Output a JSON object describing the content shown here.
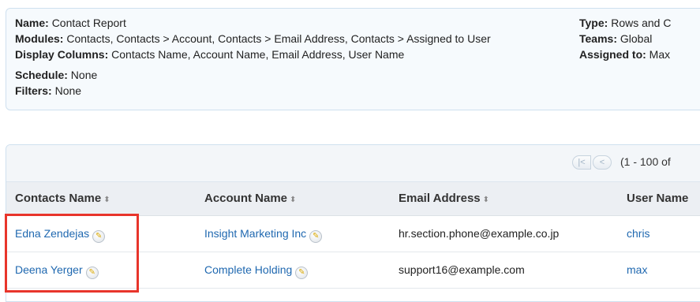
{
  "summary": {
    "name_label": "Name:",
    "name_value": "Contact Report",
    "modules_label": "Modules:",
    "modules_value": "Contacts, Contacts > Account, Contacts > Email Address, Contacts > Assigned to User",
    "display_label": "Display Columns:",
    "display_value": "Contacts Name, Account Name, Email Address, User Name",
    "schedule_label": "Schedule:",
    "schedule_value": "None",
    "filters_label": "Filters:",
    "filters_value": "None",
    "type_label": "Type:",
    "type_value": "Rows and C",
    "teams_label": "Teams:",
    "teams_value": "Global",
    "assigned_label": "Assigned to:",
    "assigned_value": "Max"
  },
  "pager": {
    "first_icon": "first-page-icon",
    "prev_icon": "prev-page-icon",
    "first_glyph": "|<",
    "prev_glyph": "<",
    "range": "(1 - 100 of"
  },
  "table": {
    "sort_glyph": "⬍",
    "columns": [
      "Contacts Name",
      "Account Name",
      "Email Address",
      "User Name"
    ],
    "rows": [
      {
        "contact": "Edna Zendejas",
        "account": "Insight Marketing Inc",
        "email": "hr.section.phone@example.co.jp",
        "user": "chris"
      },
      {
        "contact": "Deena Yerger",
        "account": "Complete Holding",
        "email": "support16@example.com",
        "user": "max"
      }
    ]
  },
  "colors": {
    "link": "#1f68b0",
    "highlight": "#e8352b"
  }
}
